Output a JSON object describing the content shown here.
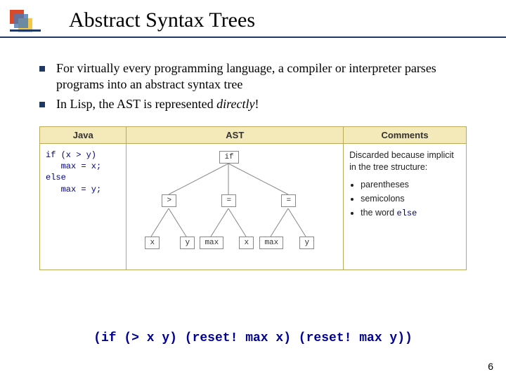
{
  "title": "Abstract Syntax Trees",
  "bullets": {
    "b1": "For virtually every programming language, a compiler or interpreter parses programs into an abstract syntax tree",
    "b2a": "In Lisp, the AST is represented ",
    "b2b": "directly",
    "b2c": "!"
  },
  "table": {
    "headers": {
      "java": "Java",
      "ast": "AST",
      "comments": "Comments"
    },
    "java_code": "if (x > y)\n   max = x;\nelse\n   max = y;",
    "comments": {
      "intro": "Discarded because implicit in the tree structure:",
      "li1": "parentheses",
      "li2": "semicolons",
      "li3a": "the word ",
      "li3b": "else"
    },
    "ast": {
      "n_if": "if",
      "n_gt": ">",
      "n_eq1": "=",
      "n_eq2": "=",
      "n_x1": "x",
      "n_y1": "y",
      "n_max1": "max",
      "n_x2": "x",
      "n_max2": "max",
      "n_y2": "y"
    }
  },
  "lisp_expr": "(if (> x y) (reset! max x) (reset! max y))",
  "page_number": "6"
}
